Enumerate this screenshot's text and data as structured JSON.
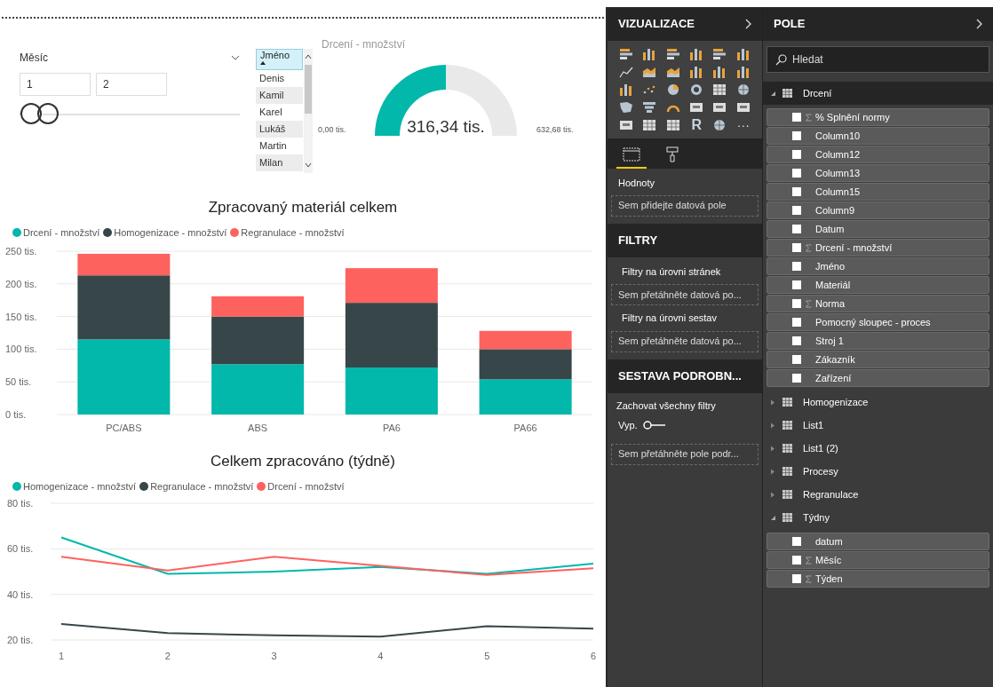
{
  "canvas": {
    "month_slicer": {
      "title": "Měsíc",
      "from": "1",
      "to": "2",
      "level": 0.03
    },
    "name_slicer": {
      "header": "Jméno",
      "items": [
        "Denis",
        "Kamil",
        "Karel",
        "Lukáš",
        "Martin",
        "Milan"
      ]
    },
    "gauge": {
      "title": "Drcení - množství",
      "value": "316,34 tis.",
      "min": "0,00 tis.",
      "max": "632,68 tis."
    },
    "bar_chart": {
      "chart_data": {
        "type": "bar",
        "title": "Zpracovaný materiál celkem",
        "stacked": true,
        "grid": true,
        "categories": [
          "PC/ABS",
          "ABS",
          "PA6",
          "PA66"
        ],
        "series": [
          {
            "name": "Drcení - množství",
            "color": "#01b8aa",
            "values": [
              115,
              77,
              72,
              54
            ]
          },
          {
            "name": "Homogenizace - množství",
            "color": "#374649",
            "values": [
              98,
              73,
              99,
              46
            ]
          },
          {
            "name": "Regranulace - množství",
            "color": "#fd625e",
            "values": [
              33,
              31,
              53,
              28
            ]
          }
        ],
        "ylim": [
          0,
          250
        ],
        "yticks": [
          {
            "value": 0,
            "label": "0 tis."
          },
          {
            "value": 50,
            "label": "50 tis."
          },
          {
            "value": 100,
            "label": "100 tis."
          },
          {
            "value": 150,
            "label": "150 tis."
          },
          {
            "value": 200,
            "label": "200 tis."
          },
          {
            "value": 250,
            "label": "250 tis."
          }
        ]
      }
    },
    "line_chart": {
      "chart_data": {
        "type": "line",
        "title": "Celkem zpracováno (týdně)",
        "grid": true,
        "categories": [
          "1",
          "2",
          "3",
          "4",
          "5",
          "6"
        ],
        "series": [
          {
            "name": "Homogenizace - množství",
            "color": "#01b8aa",
            "values": [
              65,
              49,
              50,
              52,
              49,
              53.5
            ]
          },
          {
            "name": "Regranulace - množství",
            "color": "#374649",
            "values": [
              27,
              23,
              22,
              21.5,
              26,
              25
            ]
          },
          {
            "name": "Drcení - množství",
            "color": "#fd625e",
            "values": [
              56.5,
              50.5,
              56.5,
              52.5,
              48.5,
              51.5
            ]
          }
        ],
        "ylim": [
          20,
          80
        ],
        "yticks": [
          {
            "value": 20,
            "label": "20 tis."
          },
          {
            "value": 40,
            "label": "40 tis."
          },
          {
            "value": 60,
            "label": "60 tis."
          },
          {
            "value": 80,
            "label": "80 tis."
          }
        ]
      }
    }
  },
  "visualizations": {
    "title": "VIZUALIZACE",
    "r_label": "R",
    "more_label": "···",
    "tabs": [
      {
        "kind": "fields",
        "selected": true
      },
      {
        "kind": "format",
        "selected": false
      }
    ],
    "values_label": "Hodnoty",
    "values_drop": "Sem přidejte datová pole"
  },
  "filters": {
    "title": "FILTRY",
    "groups": [
      {
        "label": "Filtry na úrovni stránek",
        "drop": "Sem přetáhněte datová po..."
      },
      {
        "label": "Filtry na úrovni sestav",
        "drop": "Sem přetáhněte datová po..."
      }
    ]
  },
  "drillthrough": {
    "title": "SESTAVA PODROBN...",
    "keep_label": "Zachovat všechny filtry",
    "toggle": {
      "label": "Vyp.",
      "on": false
    },
    "drop": "Sem přetáhněte pole podr..."
  },
  "fields": {
    "title": "POLE",
    "search": {
      "placeholder": "Hledat"
    },
    "tables": [
      {
        "name": "Drcení",
        "expanded": true,
        "selected": true,
        "children": [
          {
            "name": "% Splnění normy",
            "kind": "measure",
            "checked": false
          },
          {
            "name": "Column10",
            "kind": "column",
            "checked": false
          },
          {
            "name": "Column12",
            "kind": "column",
            "checked": false
          },
          {
            "name": "Column13",
            "kind": "column",
            "checked": false
          },
          {
            "name": "Column15",
            "kind": "column",
            "checked": false
          },
          {
            "name": "Column9",
            "kind": "column",
            "checked": false
          },
          {
            "name": "Datum",
            "kind": "column",
            "checked": false
          },
          {
            "name": "Drcení - množství",
            "kind": "measure",
            "checked": false
          },
          {
            "name": "Jméno",
            "kind": "column",
            "checked": false
          },
          {
            "name": "Materiál",
            "kind": "column",
            "checked": false
          },
          {
            "name": "Norma",
            "kind": "measure",
            "checked": false
          },
          {
            "name": "Pomocný sloupec - proces",
            "kind": "column",
            "checked": false
          },
          {
            "name": "Stroj 1",
            "kind": "column",
            "checked": false
          },
          {
            "name": "Zákazník",
            "kind": "column",
            "checked": false
          },
          {
            "name": "Zařízení",
            "kind": "column",
            "checked": false
          }
        ]
      },
      {
        "name": "Homogenizace",
        "expanded": false,
        "selected": false
      },
      {
        "name": "List1",
        "expanded": false,
        "selected": false
      },
      {
        "name": "List1 (2)",
        "expanded": false,
        "selected": false
      },
      {
        "name": "Procesy",
        "expanded": false,
        "selected": false
      },
      {
        "name": "Regranulace",
        "expanded": false,
        "selected": false
      },
      {
        "name": "Týdny",
        "expanded": true,
        "selected": false,
        "children": [
          {
            "name": "datum",
            "kind": "column",
            "checked": false
          },
          {
            "name": "Měsíc",
            "kind": "measure",
            "checked": false
          },
          {
            "name": "Týden",
            "kind": "measure",
            "checked": false
          }
        ]
      }
    ]
  }
}
